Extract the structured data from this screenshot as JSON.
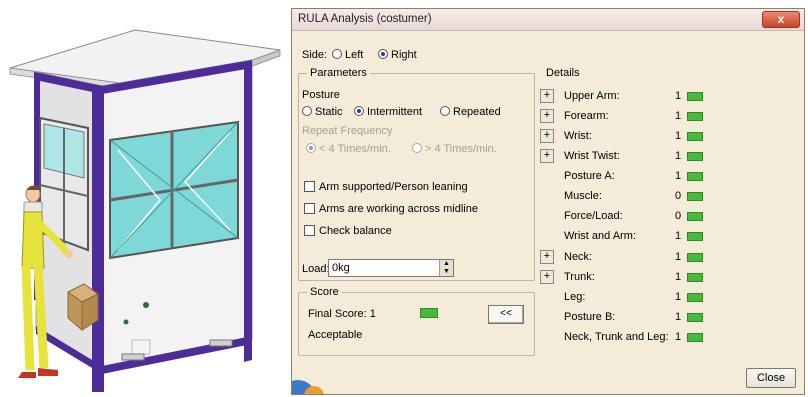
{
  "dialog": {
    "title": "RULA Analysis (costumer)",
    "close_x": "x",
    "close_button": "Close"
  },
  "side": {
    "label": "Side:",
    "left": "Left",
    "right": "Right",
    "selected": "Right"
  },
  "parameters": {
    "title": "Parameters",
    "posture_label": "Posture",
    "posture_options": [
      "Static",
      "Intermittent",
      "Repeated"
    ],
    "posture_selected": "Intermittent",
    "repeat_label": "Repeat Frequency",
    "repeat_options": [
      "< 4 Times/min.",
      "> 4 Times/min."
    ],
    "checkboxes": [
      "Arm supported/Person leaning",
      "Arms are working across midline",
      "Check balance"
    ],
    "load_label": "Load:",
    "load_value": "0kg"
  },
  "score": {
    "title": "Score",
    "final_label": "Final Score: 1",
    "verdict": "Acceptable",
    "collapse_button": "<<",
    "color": "#48b93a"
  },
  "details": {
    "title": "Details",
    "items": [
      {
        "label": "Upper Arm:",
        "value": "1"
      },
      {
        "label": "Forearm:",
        "value": "1"
      },
      {
        "label": "Wrist:",
        "value": "1"
      },
      {
        "label": "Wrist Twist:",
        "value": "1"
      },
      {
        "label": "Posture A:",
        "value": "1"
      },
      {
        "label": "Muscle:",
        "value": "0"
      },
      {
        "label": "Force/Load:",
        "value": "0"
      },
      {
        "label": "Wrist and Arm:",
        "value": "1"
      },
      {
        "label": "Neck:",
        "value": "1"
      },
      {
        "label": "Trunk:",
        "value": "1"
      },
      {
        "label": "Leg:",
        "value": "1"
      },
      {
        "label": "Posture B:",
        "value": "1"
      },
      {
        "label": "Neck, Trunk and Leg:",
        "value": "1"
      }
    ],
    "expand_symbol": "+"
  }
}
